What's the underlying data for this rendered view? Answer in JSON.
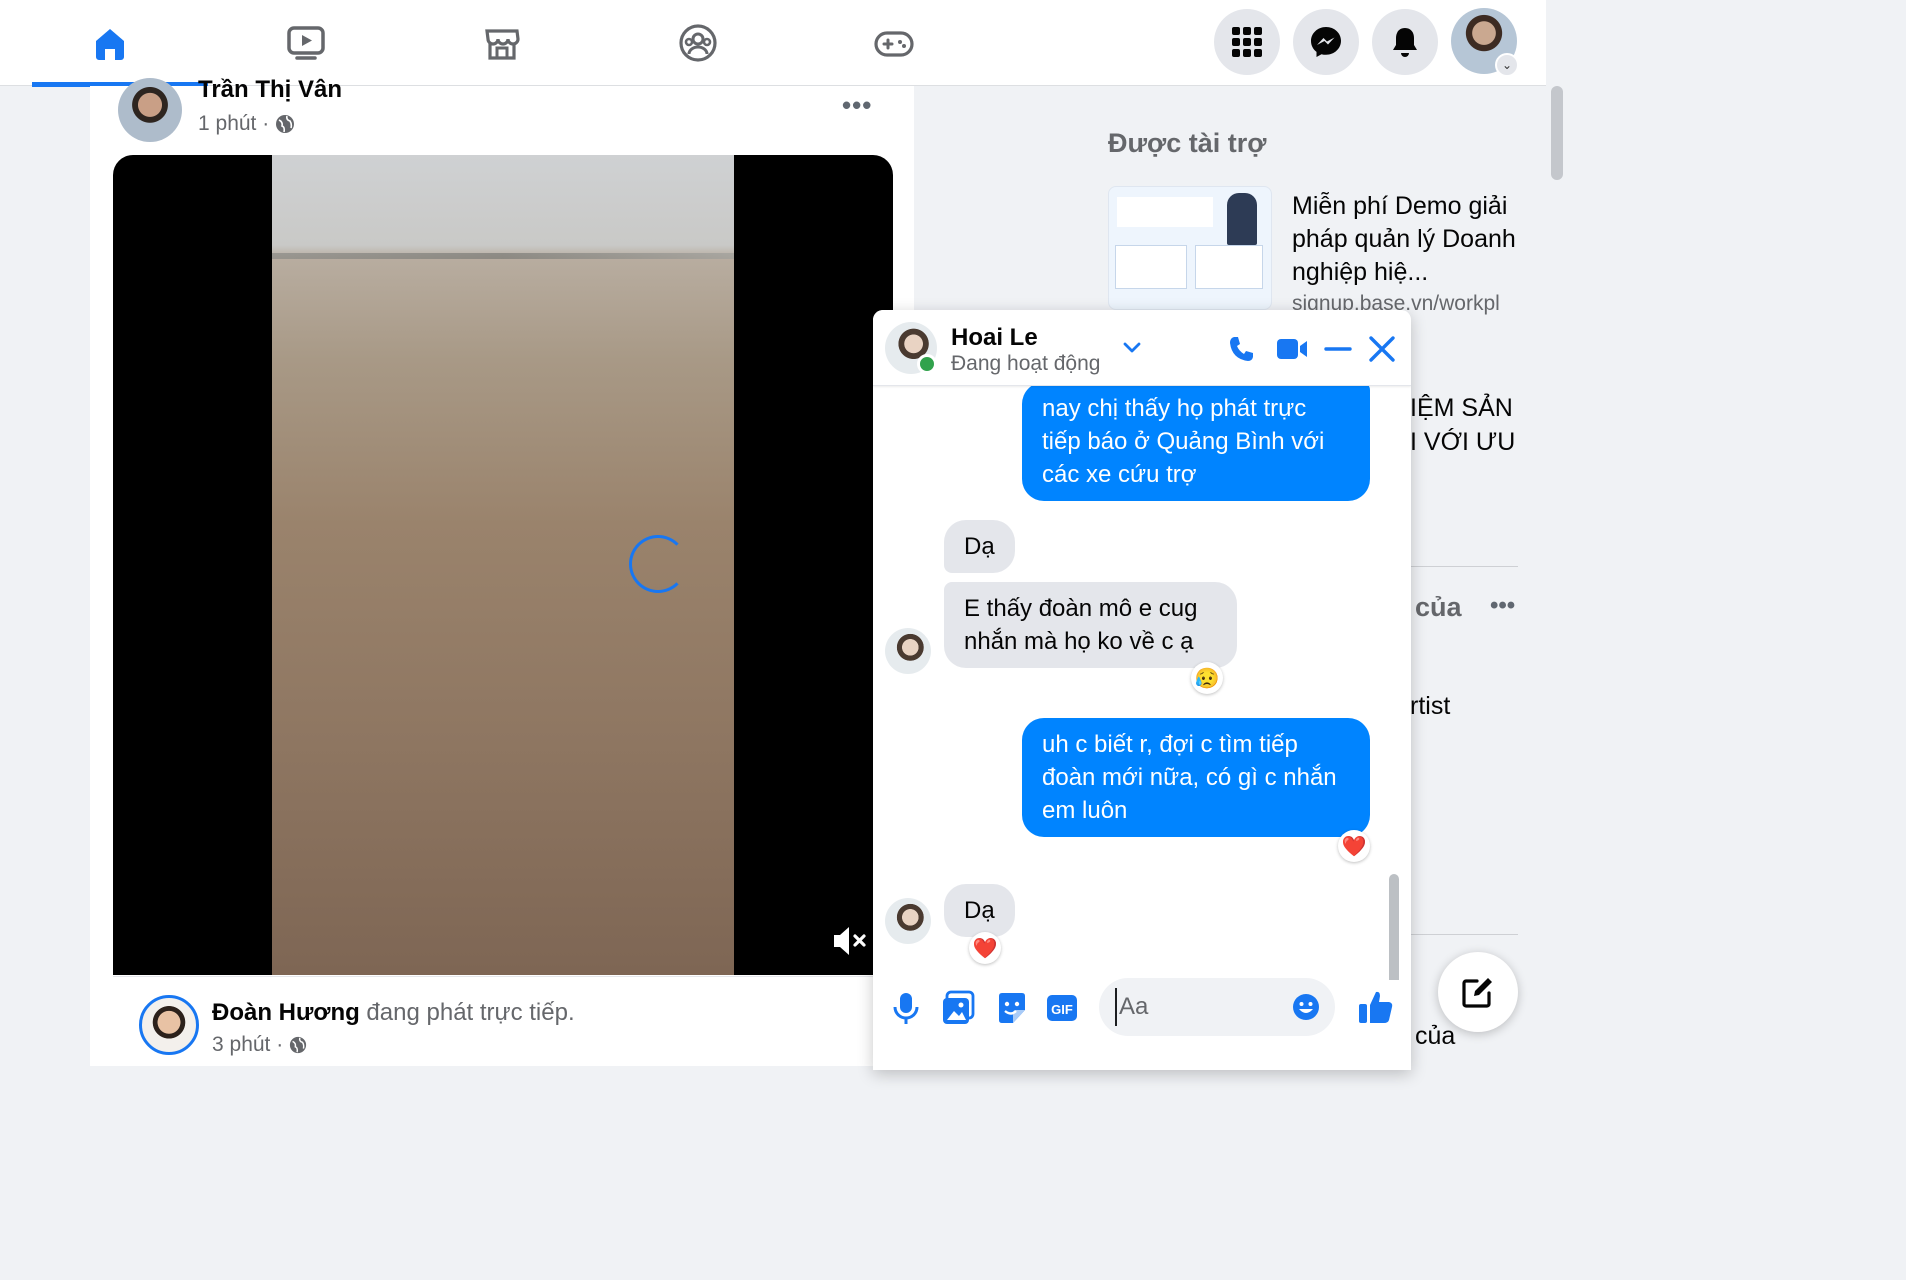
{
  "topnav": {
    "tabs": [
      {
        "name": "home",
        "active": true
      },
      {
        "name": "watch",
        "active": false
      },
      {
        "name": "marketplace",
        "active": false
      },
      {
        "name": "groups",
        "active": false
      },
      {
        "name": "gaming",
        "active": false
      }
    ],
    "right_buttons": [
      "menu-grid-icon",
      "messenger-icon",
      "notifications-bell-icon",
      "profile-avatar"
    ],
    "accent": "#1877f2"
  },
  "post": {
    "author": "Trần Thị Vân",
    "time": "1 phút ·",
    "more": "•••"
  },
  "live": {
    "name": "Đoàn Hương",
    "desc": " đang phát trực tiếp.",
    "time": "3 phút ·"
  },
  "sidebar": {
    "sponsored_title": "Được tài trợ",
    "ad1_text": "Miễn phí Demo giải pháp quản lý Doanh nghiệp hiệ...",
    "ad1_link": "signup.base.vn/workpl",
    "ad2_line1": "IỆM SẢN",
    "ad2_line2": "I VỚI ƯU",
    "heading": "của",
    "more": "•••",
    "artist": "rtist",
    "bottom": "của"
  },
  "chat": {
    "name": "Hoai Le",
    "status": "Đang hoạt động",
    "messages": [
      {
        "from": "me",
        "text": "nay chị thấy họ phát trực tiếp báo ở Quảng Bình với các xe cứu trợ"
      },
      {
        "from": "them",
        "text": "Dạ"
      },
      {
        "from": "them",
        "text": "E thấy đoàn mô e cug nhắn mà họ ko về c ạ",
        "reaction": "😥"
      },
      {
        "from": "me",
        "text": "uh c biết r, đợi c tìm tiếp đoàn mới nữa, có gì c nhắn em luôn",
        "reaction": "❤️"
      },
      {
        "from": "them",
        "text": "Dạ",
        "reaction": "❤️"
      }
    ],
    "input_placeholder": "Aa",
    "bubble_me_color": "#0084ff",
    "bubble_them_color": "#e4e6eb"
  }
}
